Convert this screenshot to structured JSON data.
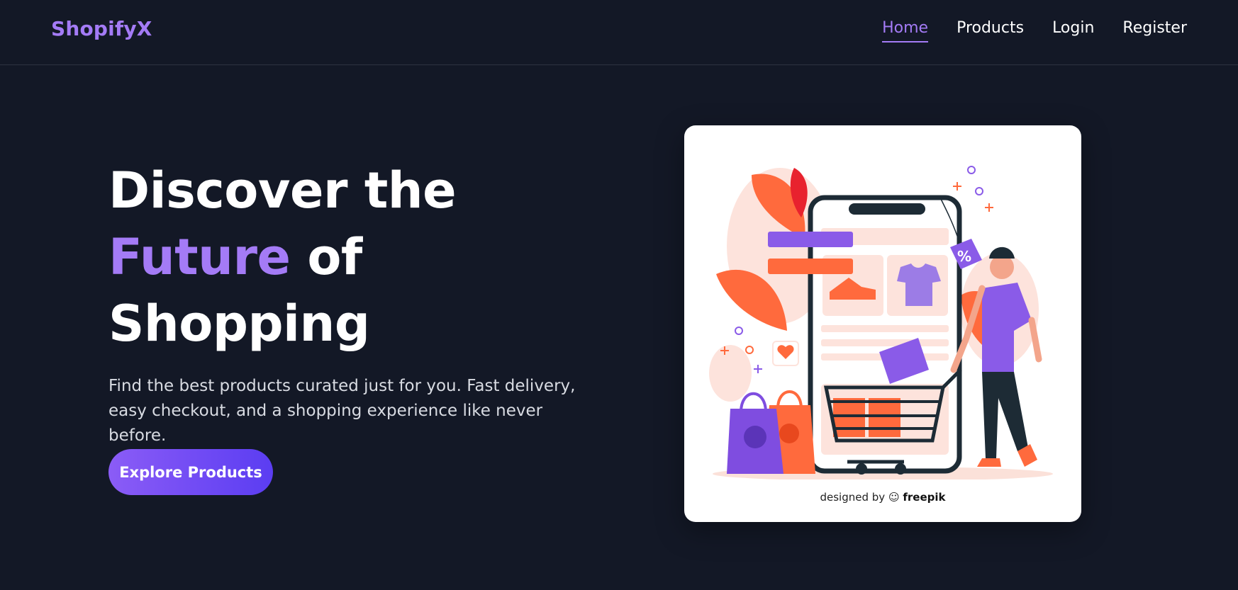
{
  "brand": {
    "name": "ShopifyX",
    "color": "#a47bf6"
  },
  "nav": {
    "items": [
      {
        "label": "Home",
        "active": true
      },
      {
        "label": "Products",
        "active": false
      },
      {
        "label": "Login",
        "active": false
      },
      {
        "label": "Register",
        "active": false
      }
    ]
  },
  "hero": {
    "title_line1": "Discover the",
    "title_accent": "Future",
    "title_line2_rest": " of",
    "title_line3": "Shopping",
    "subtitle": "Find the best products curated just for you. Fast delivery, easy checkout, and a shopping experience like never before.",
    "cta_label": "Explore Products"
  },
  "illustration": {
    "credit_prefix": "designed by",
    "credit_brand": "freepik",
    "icon": "shopping-phone-cart-illustration"
  },
  "colors": {
    "background": "#131826",
    "accent": "#a47bf6",
    "button_start": "#8b5cf6",
    "button_end": "#5b3df2"
  }
}
